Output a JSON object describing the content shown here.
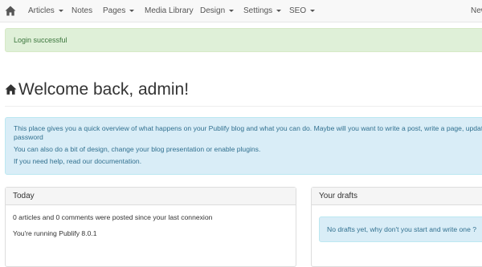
{
  "navbar": {
    "home_icon": "home-icon",
    "items": [
      {
        "label": "Articles",
        "dropdown": true
      },
      {
        "label": "Notes",
        "dropdown": false
      },
      {
        "label": "Pages",
        "dropdown": true
      },
      {
        "label": "Media Library",
        "dropdown": false
      },
      {
        "label": "Design",
        "dropdown": true
      },
      {
        "label": "Settings",
        "dropdown": true
      },
      {
        "label": "SEO",
        "dropdown": true
      }
    ],
    "right_label": "New"
  },
  "flash": {
    "message": "Login successful",
    "color": "#3c763d"
  },
  "header": {
    "icon": "home-icon",
    "title": "Welcome back, admin!"
  },
  "info": {
    "line1": "This place gives you a quick overview of what happens on your Publify blog and what you can do. Maybe will you want to write a post, write a page, update",
    "line1b": "password",
    "line2": "You can also do a bit of design, change your blog presentation or enable plugins.",
    "line3": "If you need help, read our documentation.",
    "color": "#31708f"
  },
  "today": {
    "title": "Today",
    "line1": "0 articles and 0 comments were posted since your last connexion",
    "line2": "You're running Publify 8.0.1"
  },
  "drafts": {
    "title": "Your drafts",
    "message": "No drafts yet, why don't you start and write one ?"
  }
}
